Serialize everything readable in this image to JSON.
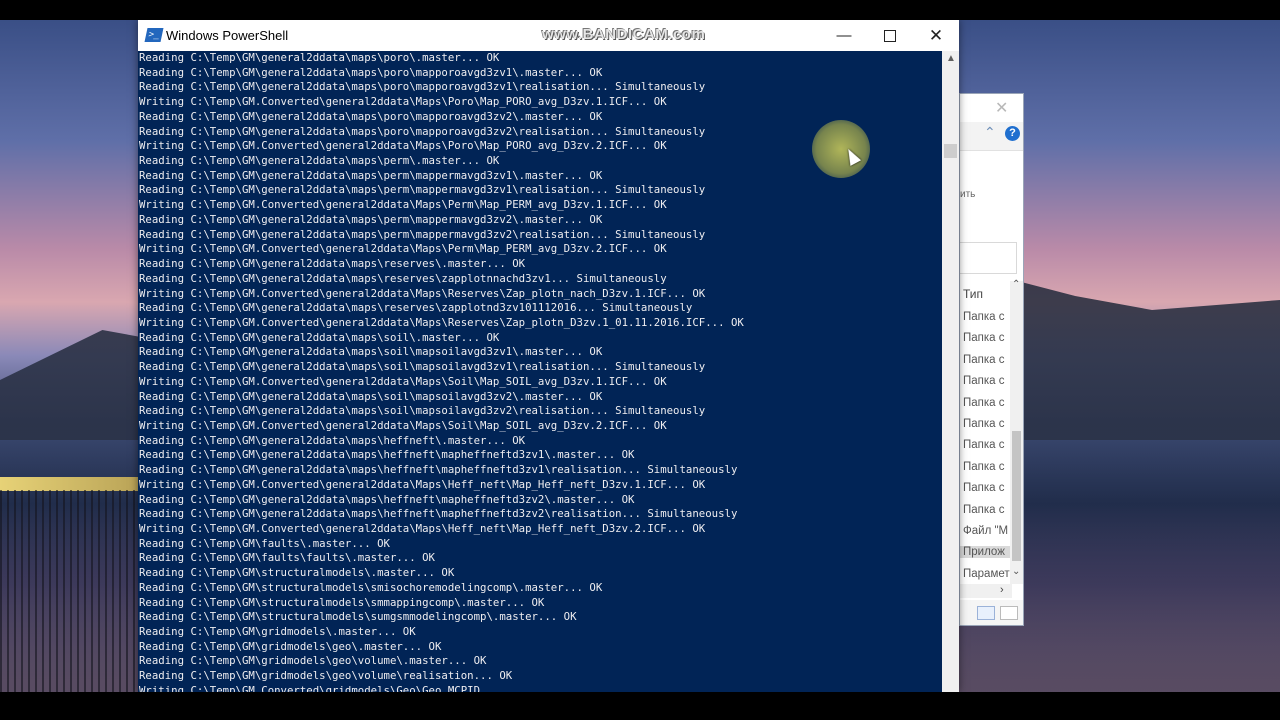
{
  "window": {
    "title": "Windows PowerShell",
    "watermark": "www.BANDICAM.com",
    "minimize": "—",
    "close": "✕"
  },
  "console_lines": [
    "Reading C:\\Temp\\GM\\general2ddata\\maps\\poro\\.master... OK",
    "Reading C:\\Temp\\GM\\general2ddata\\maps\\poro\\mapporoavgd3zv1\\.master... OK",
    "Reading C:\\Temp\\GM\\general2ddata\\maps\\poro\\mapporoavgd3zv1\\realisation... Simultaneously",
    "Writing C:\\Temp\\GM.Converted\\general2ddata\\Maps\\Poro\\Map_PORO_avg_D3zv.1.ICF... OK",
    "Reading C:\\Temp\\GM\\general2ddata\\maps\\poro\\mapporoavgd3zv2\\.master... OK",
    "Reading C:\\Temp\\GM\\general2ddata\\maps\\poro\\mapporoavgd3zv2\\realisation... Simultaneously",
    "Writing C:\\Temp\\GM.Converted\\general2ddata\\Maps\\Poro\\Map_PORO_avg_D3zv.2.ICF... OK",
    "Reading C:\\Temp\\GM\\general2ddata\\maps\\perm\\.master... OK",
    "Reading C:\\Temp\\GM\\general2ddata\\maps\\perm\\mappermavgd3zv1\\.master... OK",
    "Reading C:\\Temp\\GM\\general2ddata\\maps\\perm\\mappermavgd3zv1\\realisation... Simultaneously",
    "Writing C:\\Temp\\GM.Converted\\general2ddata\\Maps\\Perm\\Map_PERM_avg_D3zv.1.ICF... OK",
    "Reading C:\\Temp\\GM\\general2ddata\\maps\\perm\\mappermavgd3zv2\\.master... OK",
    "Reading C:\\Temp\\GM\\general2ddata\\maps\\perm\\mappermavgd3zv2\\realisation... Simultaneously",
    "Writing C:\\Temp\\GM.Converted\\general2ddata\\Maps\\Perm\\Map_PERM_avg_D3zv.2.ICF... OK",
    "Reading C:\\Temp\\GM\\general2ddata\\maps\\reserves\\.master... OK",
    "Reading C:\\Temp\\GM\\general2ddata\\maps\\reserves\\zapplotnnachd3zv1... Simultaneously",
    "Writing C:\\Temp\\GM.Converted\\general2ddata\\Maps\\Reserves\\Zap_plotn_nach_D3zv.1.ICF... OK",
    "Reading C:\\Temp\\GM\\general2ddata\\maps\\reserves\\zapplotnd3zv101112016... Simultaneously",
    "Writing C:\\Temp\\GM.Converted\\general2ddata\\Maps\\Reserves\\Zap_plotn_D3zv.1_01.11.2016.ICF... OK",
    "Reading C:\\Temp\\GM\\general2ddata\\maps\\soil\\.master... OK",
    "Reading C:\\Temp\\GM\\general2ddata\\maps\\soil\\mapsoilavgd3zv1\\.master... OK",
    "Reading C:\\Temp\\GM\\general2ddata\\maps\\soil\\mapsoilavgd3zv1\\realisation... Simultaneously",
    "Writing C:\\Temp\\GM.Converted\\general2ddata\\Maps\\Soil\\Map_SOIL_avg_D3zv.1.ICF... OK",
    "Reading C:\\Temp\\GM\\general2ddata\\maps\\soil\\mapsoilavgd3zv2\\.master... OK",
    "Reading C:\\Temp\\GM\\general2ddata\\maps\\soil\\mapsoilavgd3zv2\\realisation... Simultaneously",
    "Writing C:\\Temp\\GM.Converted\\general2ddata\\Maps\\Soil\\Map_SOIL_avg_D3zv.2.ICF... OK",
    "Reading C:\\Temp\\GM\\general2ddata\\maps\\heffneft\\.master... OK",
    "Reading C:\\Temp\\GM\\general2ddata\\maps\\heffneft\\mapheffneftd3zv1\\.master... OK",
    "Reading C:\\Temp\\GM\\general2ddata\\maps\\heffneft\\mapheffneftd3zv1\\realisation... Simultaneously",
    "Writing C:\\Temp\\GM.Converted\\general2ddata\\Maps\\Heff_neft\\Map_Heff_neft_D3zv.1.ICF... OK",
    "Reading C:\\Temp\\GM\\general2ddata\\maps\\heffneft\\mapheffneftd3zv2\\.master... OK",
    "Reading C:\\Temp\\GM\\general2ddata\\maps\\heffneft\\mapheffneftd3zv2\\realisation... Simultaneously",
    "Writing C:\\Temp\\GM.Converted\\general2ddata\\Maps\\Heff_neft\\Map_Heff_neft_D3zv.2.ICF... OK",
    "Reading C:\\Temp\\GM\\faults\\.master... OK",
    "Reading C:\\Temp\\GM\\faults\\faults\\.master... OK",
    "Reading C:\\Temp\\GM\\structuralmodels\\.master... OK",
    "Reading C:\\Temp\\GM\\structuralmodels\\smisochoremodelingcomp\\.master... OK",
    "Reading C:\\Temp\\GM\\structuralmodels\\smmappingcomp\\.master... OK",
    "Reading C:\\Temp\\GM\\structuralmodels\\sumgsmmodelingcomp\\.master... OK",
    "Reading C:\\Temp\\GM\\gridmodels\\.master... OK",
    "Reading C:\\Temp\\GM\\gridmodels\\geo\\.master... OK",
    "Reading C:\\Temp\\GM\\gridmodels\\geo\\volume\\.master... OK",
    "Reading C:\\Temp\\GM\\gridmodels\\geo\\volume\\realisation... OK",
    "Writing C:\\Temp\\GM.Converted\\gridmodels\\Geo\\Geo_MCPID"
  ],
  "explorer": {
    "close": "✕",
    "help": "?",
    "share_fragment": "ить",
    "header_type": "Тип",
    "rows": [
      "Папка с",
      "Папка с",
      "Папка с",
      "Папка с",
      "Папка с",
      "Папка с",
      "Папка с",
      "Папка с",
      "Папка с",
      "Папка с",
      "Файл \"M",
      "Прилож",
      "Парамет"
    ],
    "selected_row_index": 11
  },
  "colors": {
    "console_bg": "#012456",
    "console_fg": "#eeedf0",
    "cursor_highlight": "#e6e05a"
  },
  "icons": [
    "powershell-icon",
    "minimize-icon",
    "maximize-icon",
    "close-icon",
    "mouse-pointer-icon",
    "help-icon",
    "chevron-up-icon",
    "chevron-down-icon",
    "chevron-right-icon"
  ]
}
